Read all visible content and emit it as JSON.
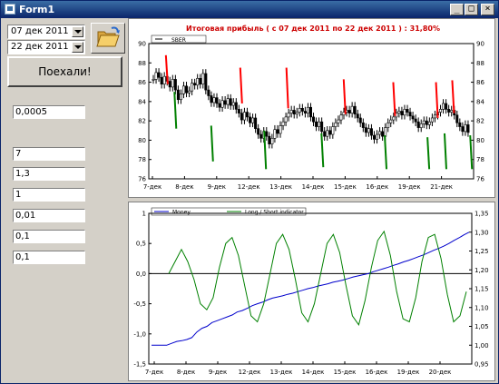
{
  "window": {
    "title": "Form1",
    "minimize": "_",
    "maximize": "□",
    "close": "×"
  },
  "controls": {
    "date_from": "07 дек 2011",
    "date_to": "22 дек 2011",
    "run_button": "Поехали!",
    "fields": [
      "0,0005",
      "7",
      "1,3",
      "1",
      "0,01",
      "0,1",
      "0,1"
    ]
  },
  "chart_data": [
    {
      "type": "candlestick",
      "title": "Итоговая прибыль ( с 07 дек 2011 по 22 дек 2011 ) : 31,80%",
      "legend": [
        "SBER"
      ],
      "x_ticks": [
        "7-дек",
        "8-дек",
        "9-дек",
        "12-дек",
        "13-дек",
        "14-дек",
        "15-дек",
        "16-дек",
        "19-дек",
        "21-дек"
      ],
      "y_ticks": [
        76,
        78,
        80,
        82,
        84,
        86,
        88,
        90
      ],
      "ylim": [
        76,
        90
      ],
      "title_color": "#cc0000",
      "signal_colors": {
        "short": "#ff0000",
        "long": "#008000"
      },
      "signals": [
        {
          "type": "short",
          "start": 88.8,
          "end": 85.8
        },
        {
          "type": "long",
          "start": 85.0,
          "end": 81.2
        },
        {
          "type": "long",
          "start": 81.5,
          "end": 77.8
        },
        {
          "type": "short",
          "start": 87.5,
          "end": 83.8
        },
        {
          "type": "long",
          "start": 81.0,
          "end": 77.0
        },
        {
          "type": "short",
          "start": 87.5,
          "end": 83.3
        },
        {
          "type": "long",
          "start": 80.7,
          "end": 77.2
        },
        {
          "type": "short",
          "start": 86.3,
          "end": 82.7
        },
        {
          "type": "long",
          "start": 80.5,
          "end": 77.0
        },
        {
          "type": "short",
          "start": 86.0,
          "end": 82.5
        },
        {
          "type": "long",
          "start": 80.3,
          "end": 77.0
        },
        {
          "type": "short",
          "start": 86.0,
          "end": 82.3
        },
        {
          "type": "long",
          "start": 80.7,
          "end": 77.0
        },
        {
          "type": "short",
          "start": 86.2,
          "end": 82.8
        },
        {
          "type": "long",
          "start": 80.5,
          "end": 77.0
        }
      ],
      "closes": [
        86.3,
        87.0,
        86.5,
        85.8,
        86.6,
        86.1,
        85.5,
        86.3,
        85.2,
        84.2,
        84.8,
        85.6,
        84.9,
        85.1,
        85.9,
        85.7,
        86.4,
        85.8,
        86.9,
        85.2,
        84.6,
        83.9,
        84.4,
        83.8,
        83.4,
        84.1,
        83.7,
        84.3,
        83.6,
        83.9,
        83.2,
        82.8,
        82.1,
        82.9,
        82.4,
        81.8,
        82.3,
        81.2,
        80.6,
        80.2,
        80.9,
        80.4,
        79.6,
        80.2,
        81.1,
        80.7,
        81.5,
        81.9,
        82.4,
        82.8,
        83.1,
        82.7,
        82.9,
        83.3,
        83.0,
        82.8,
        83.4,
        82.4,
        81.9,
        81.4,
        81.9,
        80.9,
        80.4,
        81.0,
        80.6,
        81.4,
        81.8,
        82.1,
        82.6,
        82.9,
        83.1,
        82.8,
        83.5,
        82.7,
        82.3,
        81.8,
        81.3,
        80.8,
        81.2,
        80.5,
        80.1,
        80.6,
        80.9,
        80.4,
        81.3,
        81.8,
        82.1,
        82.4,
        82.8,
        83.0,
        82.6,
        83.2,
        82.9,
        82.5,
        82.2,
        81.9,
        81.3,
        81.7,
        82.0,
        81.6,
        81.9,
        82.3,
        82.6,
        82.9,
        83.2,
        83.8,
        83.2,
        82.9,
        83.1,
        82.6,
        81.8,
        81.4,
        80.9,
        81.6,
        80.8
      ]
    },
    {
      "type": "line",
      "legend": [
        "Money",
        "Long / Short indicator"
      ],
      "series_colors": [
        "#0000cc",
        "#008000"
      ],
      "x_ticks": [
        "7-дек",
        "8-дек",
        "9-дек",
        "12-дек",
        "13-дек",
        "14-дек",
        "15-дек",
        "16-дек",
        "19-дек",
        "20-дек"
      ],
      "y_left_ticks": [
        "1",
        "0,5",
        "0,0",
        "-0,5",
        "-1,0",
        "-1,5"
      ],
      "y_left_lim": [
        -1.5,
        1
      ],
      "y_right_ticks": [
        "1,35",
        "1,30",
        "1,25",
        "1,20",
        "1,15",
        "1,10",
        "1,05",
        "1,00",
        "0,95"
      ],
      "y_right_lim": [
        0.95,
        1.35
      ],
      "series": [
        {
          "name": "Money",
          "values": [
            1.0,
            1.0,
            1.0,
            1.0,
            1.005,
            1.01,
            1.012,
            1.015,
            1.02,
            1.035,
            1.045,
            1.05,
            1.06,
            1.065,
            1.07,
            1.075,
            1.08,
            1.088,
            1.092,
            1.098,
            1.105,
            1.11,
            1.114,
            1.12,
            1.125,
            1.128,
            1.131,
            1.135,
            1.138,
            1.142,
            1.146,
            1.15,
            1.153,
            1.157,
            1.16,
            1.163,
            1.167,
            1.17,
            1.173,
            1.177,
            1.181,
            1.184,
            1.187,
            1.19,
            1.195,
            1.199,
            1.203,
            1.207,
            1.212,
            1.216,
            1.221,
            1.225,
            1.23,
            1.235,
            1.24,
            1.246,
            1.252,
            1.257,
            1.263,
            1.27,
            1.278,
            1.285,
            1.293,
            1.3
          ]
        },
        {
          "name": "Long / Short indicator",
          "values": [
            0.0,
            0.2,
            0.4,
            0.2,
            -0.1,
            -0.5,
            -0.6,
            -0.4,
            0.1,
            0.5,
            0.6,
            0.3,
            -0.2,
            -0.7,
            -0.8,
            -0.5,
            0.0,
            0.5,
            0.65,
            0.4,
            -0.1,
            -0.65,
            -0.8,
            -0.5,
            0.0,
            0.5,
            0.65,
            0.35,
            -0.2,
            -0.7,
            -0.85,
            -0.45,
            0.1,
            0.55,
            0.7,
            0.3,
            -0.3,
            -0.75,
            -0.8,
            -0.4,
            0.2,
            0.6,
            0.65,
            0.25,
            -0.35,
            -0.8,
            -0.7,
            -0.3
          ]
        }
      ]
    }
  ]
}
